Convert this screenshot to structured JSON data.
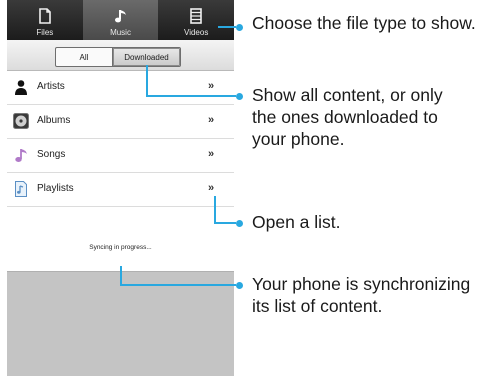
{
  "tabs": [
    {
      "label": "Files",
      "icon": "file-icon"
    },
    {
      "label": "Music",
      "icon": "music-note-icon",
      "active": true
    },
    {
      "label": "Videos",
      "icon": "film-icon"
    }
  ],
  "filter": {
    "options": [
      "All",
      "Downloaded"
    ],
    "selected": "Downloaded"
  },
  "list": [
    {
      "label": "Artists",
      "icon": "person-icon",
      "chevron": "»"
    },
    {
      "label": "Albums",
      "icon": "album-icon",
      "chevron": "»"
    },
    {
      "label": "Songs",
      "icon": "music-note-icon",
      "chevron": "»"
    },
    {
      "label": "Playlists",
      "icon": "playlist-icon",
      "chevron": "»"
    }
  ],
  "status": "Syncing in progress...",
  "callouts": {
    "file_type": "Choose the file type to show.",
    "filter": "Show all content, or only the ones downloaded to your phone.",
    "open_list": "Open a list.",
    "syncing": "Your phone is synchronizing its list of content."
  },
  "colors": {
    "accent": "#29a8e0"
  }
}
